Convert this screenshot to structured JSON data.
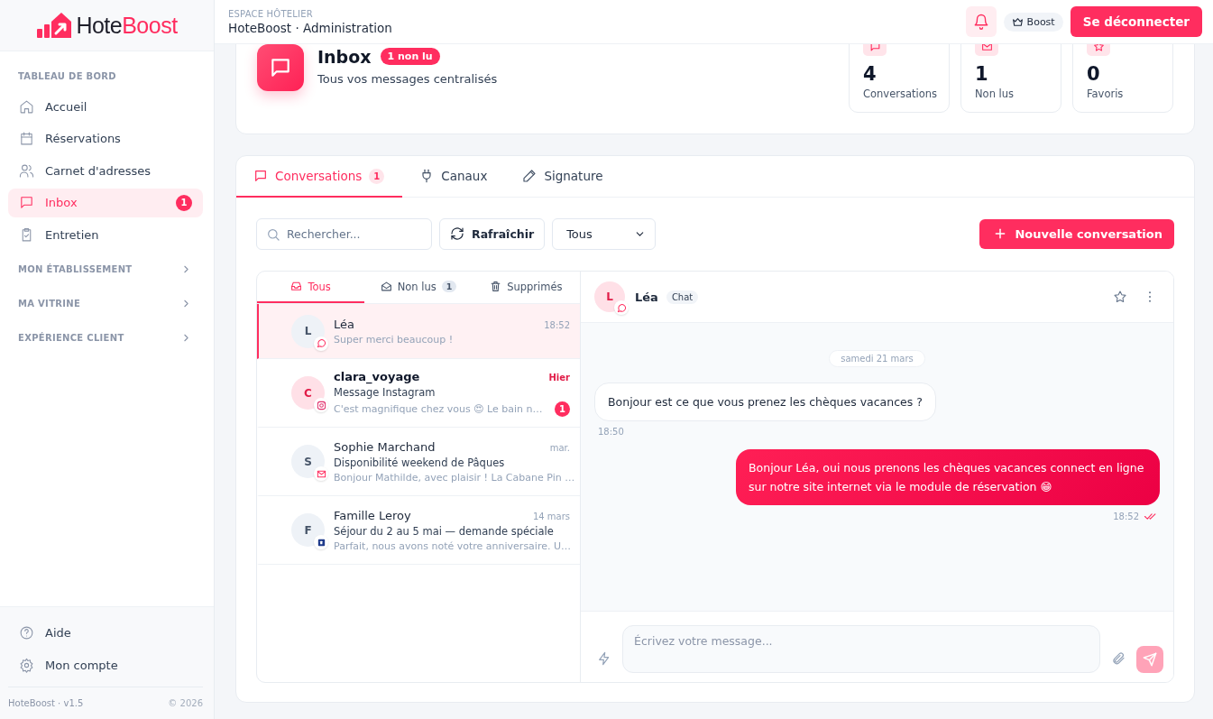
{
  "sidebar": {
    "logo": {
      "part_1": "Hote",
      "part_2": "Boost"
    },
    "nav": [
      {
        "kind": "header",
        "label": "TABLEAU DE BORD"
      },
      {
        "kind": "item",
        "label": "Accueil",
        "selected": false
      },
      {
        "kind": "item",
        "label": "Réservations",
        "selected": false
      },
      {
        "kind": "item",
        "label": "Carnet d'adresses",
        "selected": false
      },
      {
        "kind": "item",
        "label": "Inbox",
        "selected": true,
        "badge": "1"
      },
      {
        "kind": "item",
        "label": "Entretien",
        "selected": false
      },
      {
        "kind": "group",
        "label": "MON ÉTABLISSEMENT",
        "expanded": false
      },
      {
        "kind": "group",
        "label": "MA VITRINE",
        "expanded": false
      },
      {
        "kind": "group",
        "label": "EXPÉRIENCE CLIENT",
        "expanded": false
      }
    ],
    "bottom": [
      {
        "label": "Aide"
      },
      {
        "label": "Mon compte"
      }
    ],
    "footer": {
      "version": "HoteBoost · v1.5",
      "copyright": "© 2026"
    }
  },
  "topbar": {
    "eyebrow": "ESPACE HÔTELIER",
    "title": "HoteBoost · Administration",
    "plan": "Boost",
    "logout": "Se déconnecter"
  },
  "header": {
    "title": "Inbox",
    "badge": "1 non lu",
    "subtitle": "Tous vos messages centralisés",
    "stats": [
      {
        "value": "4",
        "label": "Conversations"
      },
      {
        "value": "1",
        "label": "Non lus"
      },
      {
        "value": "0",
        "label": "Favoris"
      }
    ]
  },
  "tabs": [
    {
      "label": "Conversations",
      "count": "1",
      "selected": true
    },
    {
      "label": "Canaux",
      "selected": false
    },
    {
      "label": "Signature",
      "selected": false
    }
  ],
  "toolbar": {
    "search": {
      "placeholder": "Rechercher..."
    },
    "refresh": "Rafraîchir",
    "filter": "Tous",
    "new_button": "Nouvelle conversation"
  },
  "filters": [
    {
      "label": "Tous",
      "selected": true
    },
    {
      "label": "Non lus",
      "count": "1",
      "selected": false
    },
    {
      "label": "Supprimés",
      "selected": false
    }
  ],
  "conversations": [
    {
      "initial": "L",
      "name": "Léa",
      "time": "18:52",
      "preview": "Super merci beaucoup !",
      "kind": "chat",
      "unread": false,
      "selected": true
    },
    {
      "initial": "C",
      "name": "clara_voyage",
      "time": "Hier",
      "subject": "Message Instagram",
      "preview": "C'est magnifique chez vous 😍 Le bain n…",
      "kind": "instagram",
      "unread": true,
      "count": "1",
      "selected": false
    },
    {
      "initial": "S",
      "name": "Sophie Marchand",
      "time": "mar.",
      "subject": "Disponibilité weekend de Pâques",
      "preview": "Bonjour Mathilde, avec plaisir ! La Cabane Pin …",
      "kind": "email",
      "unread": false,
      "selected": false
    },
    {
      "initial": "F",
      "name": "Famille Leroy",
      "time": "14 mars",
      "subject": "Séjour du 2 au 5 mai — demande spéciale",
      "preview": "Parfait, nous avons noté votre anniversaire. U…",
      "kind": "booking",
      "unread": false,
      "selected": false
    }
  ],
  "chat": {
    "initial": "L",
    "name": "Léa",
    "kind": "chat",
    "tag": "Chat",
    "favorite": false,
    "date": "samedi 21 mars",
    "messages": [
      {
        "kind": "incoming",
        "text": "Bonjour est ce que vous prenez les chèques vacances ?",
        "time": "18:50"
      },
      {
        "kind": "outgoing",
        "text": "Bonjour Léa, oui nous prenons les chèques vacances connect en ligne sur notre site internet via le module de réservation 😁",
        "time": "18:52",
        "read": true
      }
    ],
    "composer": {
      "placeholder": "Écrivez votre message..."
    }
  }
}
